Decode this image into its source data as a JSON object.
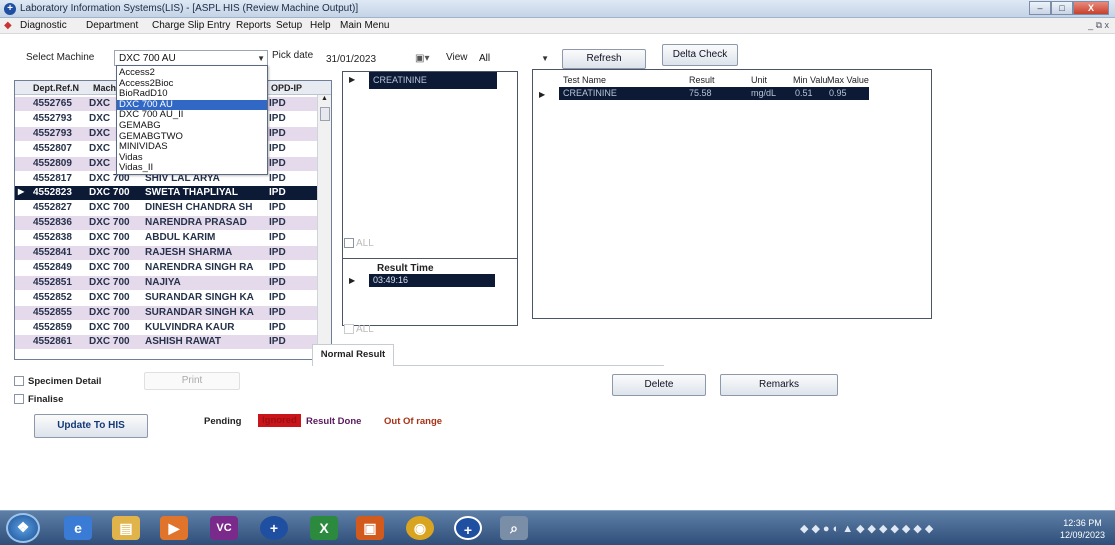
{
  "window": {
    "title": "Laboratory Information Systems(LIS) - [ASPL HIS (Review Machine Output)]",
    "minimize": "–",
    "maximize": "□",
    "close": "X"
  },
  "menu": [
    "Diagnostic",
    "Department",
    "Charge Slip Entry",
    "Reports",
    "Setup",
    "Help",
    "Main Menu"
  ],
  "mdi_controls": "_ ⧉ x",
  "toolbar": {
    "select_machine_label": "Select Machine",
    "machine_value": "DXC 700 AU",
    "pick_date_label": "Pick date",
    "pick_date_value": "31/01/2023",
    "view_label": "View",
    "view_value": "All",
    "refresh_label": "Refresh",
    "delta_check_label": "Delta Check"
  },
  "machine_options": [
    "Access2",
    "Access2Bioc",
    "BioRadD10",
    "DXC 700 AU",
    "DXC 700 AU_II",
    "GEMABG",
    "GEMABGTWO",
    "MINIVIDAS",
    "Vidas",
    "Vidas_II"
  ],
  "machine_selected_index": 3,
  "patient_grid": {
    "columns": [
      "Dept.Ref.N",
      "Mach",
      "OPD-IP"
    ],
    "rows": [
      {
        "ref": "4552765",
        "machine": "DXC",
        "name": "",
        "opd": "IPD"
      },
      {
        "ref": "4552793",
        "machine": "DXC",
        "name": "",
        "opd": "IPD"
      },
      {
        "ref": "4552793",
        "machine": "DXC",
        "name": "",
        "opd": "IPD"
      },
      {
        "ref": "4552807",
        "machine": "DXC",
        "name": "",
        "opd": "IPD"
      },
      {
        "ref": "4552809",
        "machine": "DXC",
        "name": "",
        "opd": "IPD"
      },
      {
        "ref": "4552817",
        "machine": "DXC 700",
        "name": "SHIV LAL ARYA",
        "opd": "IPD"
      },
      {
        "ref": "4552823",
        "machine": "DXC 700",
        "name": "SWETA THAPLIYAL",
        "opd": "IPD"
      },
      {
        "ref": "4552827",
        "machine": "DXC 700",
        "name": "DINESH CHANDRA SH",
        "opd": "IPD"
      },
      {
        "ref": "4552836",
        "machine": "DXC 700",
        "name": "NARENDRA PRASAD",
        "opd": "IPD"
      },
      {
        "ref": "4552838",
        "machine": "DXC 700",
        "name": "ABDUL KARIM",
        "opd": "IPD"
      },
      {
        "ref": "4552841",
        "machine": "DXC 700",
        "name": "RAJESH SHARMA",
        "opd": "IPD"
      },
      {
        "ref": "4552849",
        "machine": "DXC 700",
        "name": "NARENDRA SINGH RA",
        "opd": "IPD"
      },
      {
        "ref": "4552851",
        "machine": "DXC 700",
        "name": "NAJIYA",
        "opd": "IPD"
      },
      {
        "ref": "4552852",
        "machine": "DXC 700",
        "name": "SURANDAR SINGH KA",
        "opd": "IPD"
      },
      {
        "ref": "4552855",
        "machine": "DXC 700",
        "name": "SURANDAR SINGH KA",
        "opd": "IPD"
      },
      {
        "ref": "4552859",
        "machine": "DXC 700",
        "name": "KULVINDRA KAUR",
        "opd": "IPD"
      },
      {
        "ref": "4552861",
        "machine": "DXC 700",
        "name": "ASHISH RAWAT",
        "opd": "IPD"
      }
    ],
    "selected_index": 6
  },
  "test_list": {
    "selected": "CREATININE",
    "all_label": "ALL"
  },
  "result_time": {
    "header": "Result Time",
    "value": "03:49:16",
    "all_label": "ALL"
  },
  "results_grid": {
    "columns": [
      "Test Name",
      "Result",
      "Unit",
      "Min Valu",
      "Max Value"
    ],
    "rows": [
      {
        "test": "CREATININE",
        "result": "75.58",
        "unit": "mg/dL",
        "min": "0.51",
        "max": "0.95"
      }
    ]
  },
  "normal_result_tab": "Normal Result",
  "specimen_detail_label": "Specimen Detail",
  "print_label": "Print",
  "finalise_label": "Finalise",
  "update_button": "Update To HIS",
  "delete_button": "Delete",
  "remarks_button": "Remarks",
  "legend": {
    "pending": "Pending",
    "ignored": "Ignored",
    "result_done": "Result Done",
    "out_of_range": "Out Of range",
    "ignored_color": "#c9141a",
    "result_done_color": "#5a1a5e",
    "out_of_range_color": "#a83214"
  },
  "taskbar": {
    "time": "12:36 PM",
    "date": "12/09/2023"
  }
}
